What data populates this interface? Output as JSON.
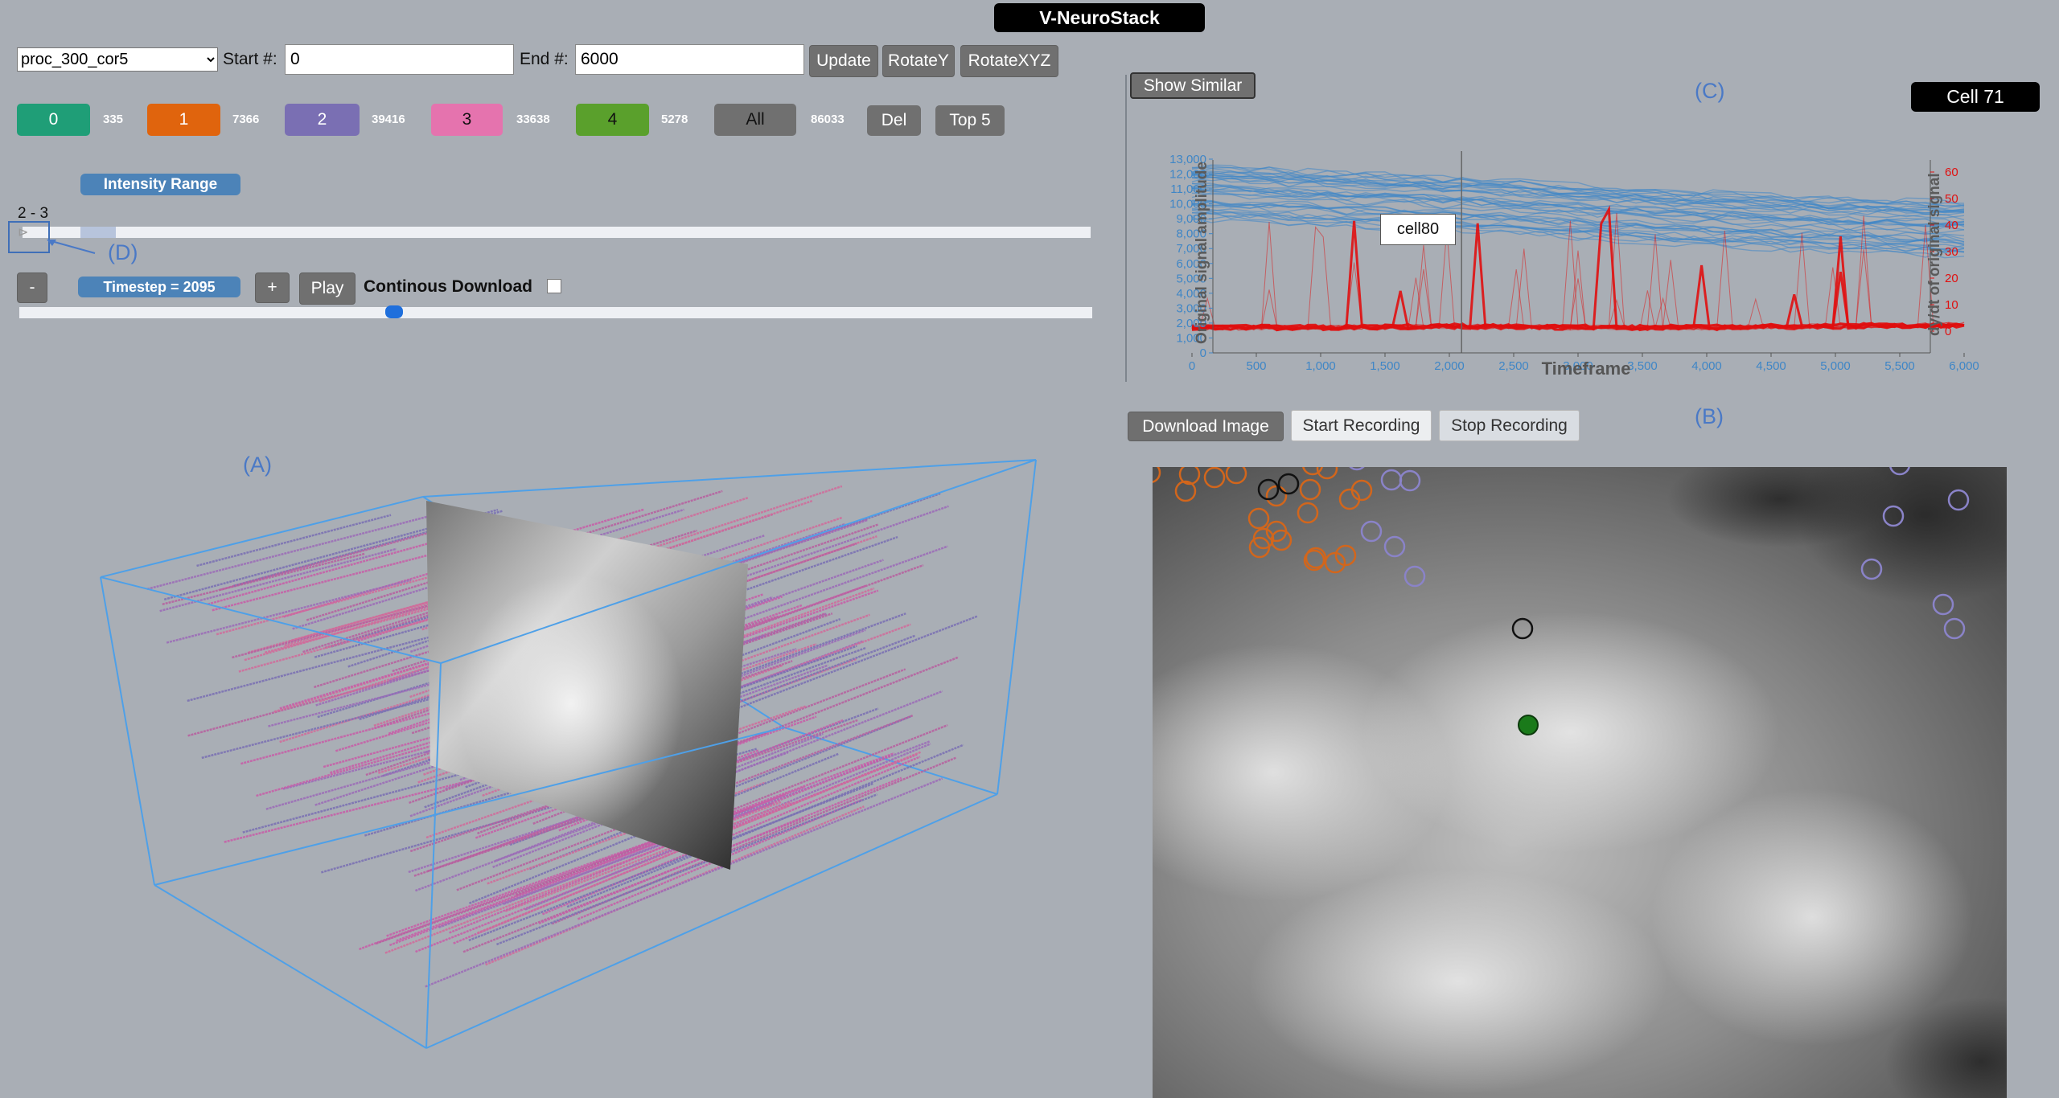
{
  "app": {
    "title": "V-NeuroStack"
  },
  "controls": {
    "dataset": "proc_300_cor5",
    "start_label": "Start #:",
    "start_value": "0",
    "end_label": "End #:",
    "end_value": "6000",
    "update_label": "Update",
    "rotatey_label": "RotateY",
    "rotatexyz_label": "RotateXYZ"
  },
  "clusters": [
    {
      "label": "0",
      "count": "335",
      "color": "#1f9e77"
    },
    {
      "label": "1",
      "count": "7366",
      "color": "#e0640d"
    },
    {
      "label": "2",
      "count": "39416",
      "color": "#7a6fb3"
    },
    {
      "label": "3",
      "count": "33638",
      "color": "#e573ae"
    },
    {
      "label": "4",
      "count": "5278",
      "color": "#5aa02c"
    },
    {
      "label": "All",
      "count": "86033",
      "color": "#707070"
    }
  ],
  "cluster_actions": {
    "del_label": "Del",
    "top5_label": "Top 5"
  },
  "intensity": {
    "label": "Intensity Range",
    "range_text": "2 - 3"
  },
  "timestep": {
    "minus_label": "-",
    "label": "Timestep = 2095",
    "plus_label": "+",
    "play_label": "Play",
    "continuous_label": "Continous Download",
    "value": 2095,
    "max": 6000
  },
  "annotations": {
    "a": "(A)",
    "b": "(B)",
    "c": "(C)",
    "d": "(D)"
  },
  "similar": {
    "show_similar_label": "Show Similar",
    "cell_badge": "Cell 71",
    "tooltip": "cell80"
  },
  "recording": {
    "download_label": "Download Image",
    "start_label": "Start Recording",
    "stop_label": "Stop Recording"
  },
  "chart_data": {
    "type": "line",
    "xlabel": "Timeframe",
    "ylabel": "Original signal amplitude",
    "ylabel_right": "dy/dt of original signal",
    "xlim": [
      0,
      6000
    ],
    "ylim": [
      0,
      13000
    ],
    "ylim_right": [
      -5,
      60
    ],
    "x_ticks": [
      "0",
      "500",
      "1,000",
      "1,500",
      "2,000",
      "2,500",
      "3,000",
      "3,500",
      "4,000",
      "4,500",
      "5,000",
      "5,500",
      "6,000"
    ],
    "y_ticks": [
      "0",
      "1,000",
      "2,000",
      "3,000",
      "4,000",
      "5,000",
      "6,000",
      "7,000",
      "8,000",
      "9,000",
      "10,000",
      "11,000",
      "12,000",
      "13,000"
    ],
    "y_right_ticks": [
      "0",
      "10",
      "20",
      "30",
      "40",
      "50",
      "60"
    ],
    "series": [
      {
        "color": "#3f86c6",
        "description": "original amplitude",
        "x": [
          0,
          1000,
          2000,
          3000,
          4000,
          5000,
          6000
        ],
        "values": [
          10800,
          10400,
          10000,
          9500,
          9000,
          8600,
          8300
        ]
      },
      {
        "color": "#e01010",
        "description": "dy/dt",
        "x": [
          0,
          1000,
          2000,
          3000,
          4000,
          5000,
          6000
        ],
        "values": [
          1,
          1,
          1.5,
          1,
          1,
          1.5,
          2
        ]
      }
    ],
    "marker_x": 2095
  },
  "colors": {
    "orange_cell": "#d2661c",
    "purple_cell": "#8a83c8",
    "black_cell": "#111111",
    "selected_cell": "#1a7a1a",
    "box": "#4ea0e8"
  }
}
